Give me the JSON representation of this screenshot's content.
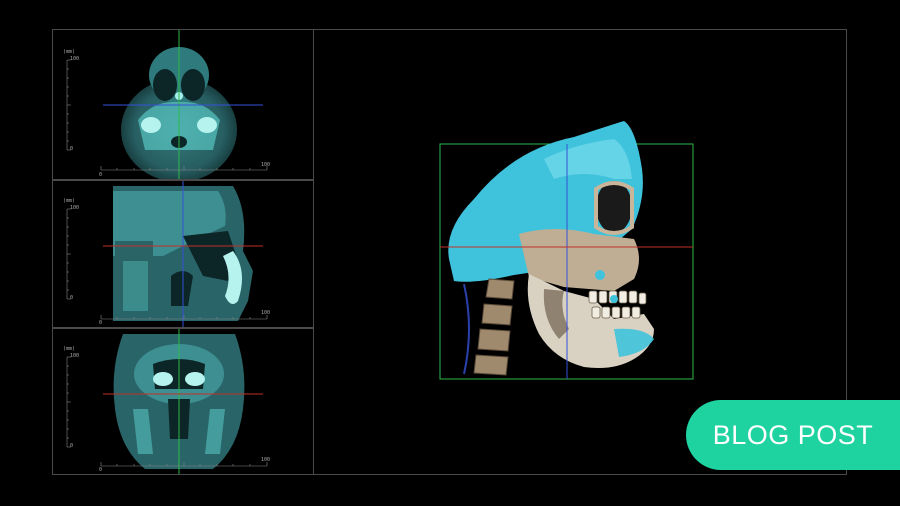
{
  "app": {
    "views": {
      "axial": {
        "vertical_scale_top": "100",
        "vertical_scale_bottom": "0",
        "horizontal_scale_start": "0",
        "horizontal_scale_end": "100",
        "unit": "(mm)"
      },
      "sagittal": {
        "vertical_scale_top": "100",
        "vertical_scale_bottom": "0",
        "horizontal_scale_start": "0",
        "horizontal_scale_end": "100",
        "unit": "(mm)"
      },
      "coronal": {
        "vertical_scale_top": "100",
        "vertical_scale_bottom": "0",
        "horizontal_scale_start": "0",
        "horizontal_scale_end": "100",
        "unit": "(mm)"
      }
    },
    "volume_render": {
      "icon": "skull-3d-render-icon"
    },
    "colors": {
      "scan_tint": "#5fd6d0",
      "bone_highlight": "#3fc3dc",
      "crosshair_green": "#2fb84a",
      "crosshair_blue": "#3550d8",
      "crosshair_red": "#c0302a",
      "badge": "#1ed3a0"
    }
  },
  "badge": {
    "label": "BLOG POST"
  }
}
